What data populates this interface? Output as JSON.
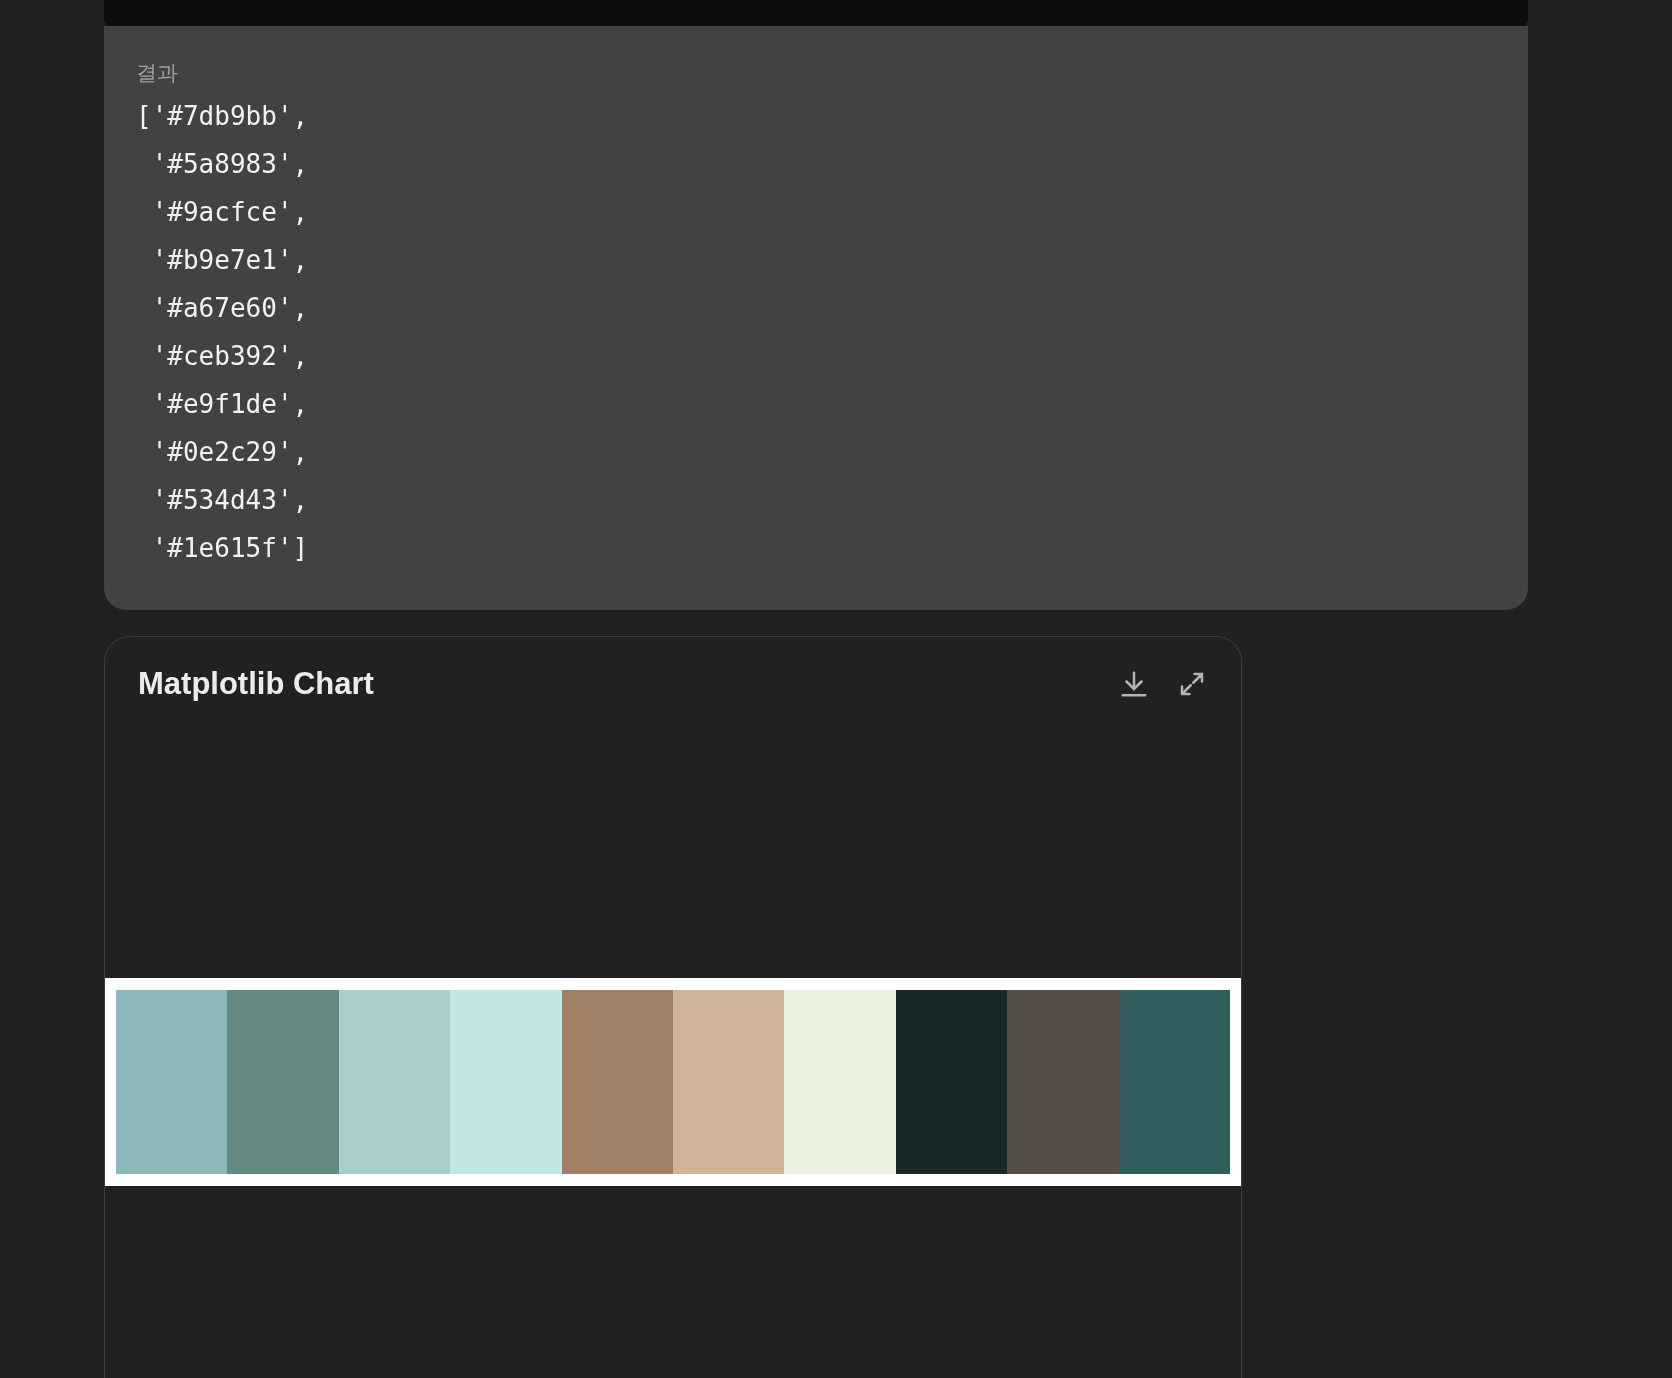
{
  "result": {
    "label": "결과",
    "lines": [
      "['#7db9bb',",
      " '#5a8983',",
      " '#9acfce',",
      " '#b9e7e1',",
      " '#a67e60',",
      " '#ceb392',",
      " '#e9f1de',",
      " '#0e2c29',",
      " '#534d43',",
      " '#1e615f']"
    ]
  },
  "chart": {
    "title": "Matplotlib Chart",
    "swatches": [
      {
        "color": "#8db8bb"
      },
      {
        "color": "#648983"
      },
      {
        "color": "#a7cecd"
      },
      {
        "color": "#c0e7e1"
      },
      {
        "color": "#a08064"
      },
      {
        "color": "#ceb396"
      },
      {
        "color": "#e9f1e1"
      },
      {
        "color": "#182a27"
      },
      {
        "color": "#534d43"
      },
      {
        "color": "#315f5d"
      }
    ]
  }
}
